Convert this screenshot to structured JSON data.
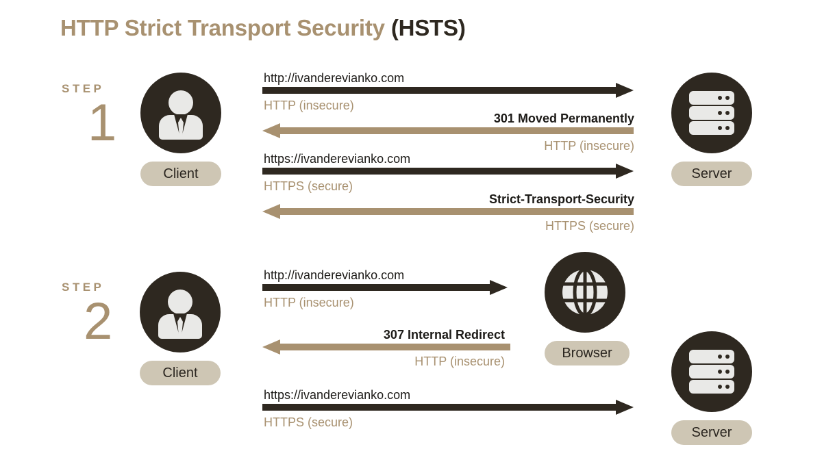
{
  "title": {
    "main": "HTTP Strict Transport Security ",
    "sub": "(HSTS)"
  },
  "colors": {
    "tan": "#a89170",
    "dark": "#2e2820",
    "pill": "#cec6b4",
    "icon_fill": "#e9e9e7",
    "background": "#ffffff"
  },
  "steps": [
    {
      "word": "STEP",
      "number": "1"
    },
    {
      "word": "STEP",
      "number": "2"
    }
  ],
  "nodes": {
    "client1": {
      "label": "Client",
      "icon": "person-icon"
    },
    "server1": {
      "label": "Server",
      "icon": "server-icon"
    },
    "client2": {
      "label": "Client",
      "icon": "person-icon"
    },
    "browser": {
      "label": "Browser",
      "icon": "globe-icon"
    },
    "server2": {
      "label": "Server",
      "icon": "server-icon"
    }
  },
  "step1_messages": [
    {
      "top": "http://ivanderevianko.com",
      "bottom": "HTTP (insecure)",
      "direction": "right",
      "color": "dark",
      "align": "left"
    },
    {
      "top": "301 Moved Permanently",
      "bottom": "HTTP (insecure)",
      "direction": "left",
      "color": "tan",
      "align": "right"
    },
    {
      "top": "https://ivanderevianko.com",
      "bottom": "HTTPS (secure)",
      "direction": "right",
      "color": "dark",
      "align": "left"
    },
    {
      "top": "Strict-Transport-Security",
      "bottom": "HTTPS (secure)",
      "direction": "left",
      "color": "tan",
      "align": "right"
    }
  ],
  "step2_messages": [
    {
      "top": "http://ivanderevianko.com",
      "bottom": "HTTP (insecure)",
      "direction": "right",
      "color": "dark",
      "align": "left"
    },
    {
      "top": "307 Internal Redirect",
      "bottom": "HTTP (insecure)",
      "direction": "left",
      "color": "tan",
      "align": "right"
    },
    {
      "top": "https://ivanderevianko.com",
      "bottom": "HTTPS (secure)",
      "direction": "right",
      "color": "dark",
      "align": "left"
    }
  ]
}
